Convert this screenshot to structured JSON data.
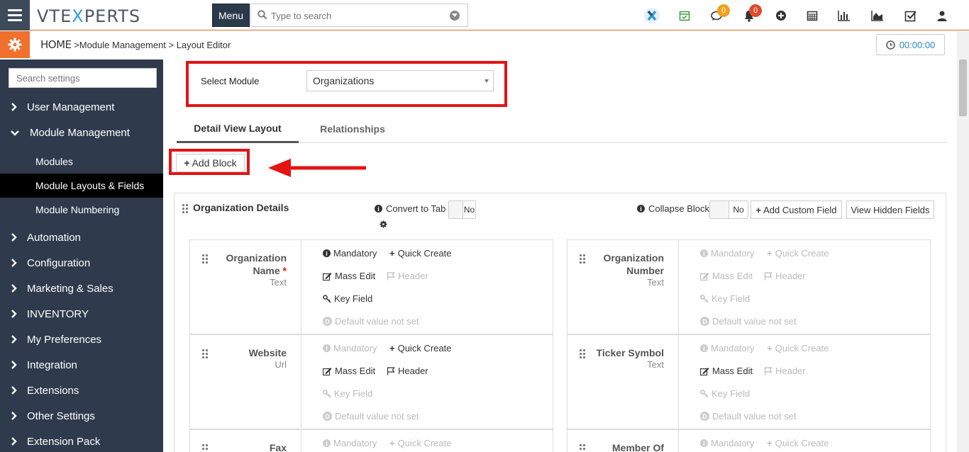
{
  "header": {
    "logo_prefix": "VTE",
    "logo_x": "X",
    "logo_suffix": "PERTS",
    "menu_label": "Menu",
    "search_placeholder": "Type to search",
    "chat_badge": "0",
    "notif_badge": "0"
  },
  "breadcrumb": {
    "home": "HOME",
    "sep1": " >",
    "module_mgmt": "Module Management",
    "sep2": " > ",
    "current": "Layout Editor"
  },
  "timer": "00:00:00",
  "sidebar": {
    "search_placeholder": "Search settings",
    "items": [
      {
        "label": "User Management"
      },
      {
        "label": "Module Management"
      },
      {
        "label": "Automation"
      },
      {
        "label": "Configuration"
      },
      {
        "label": "Marketing & Sales"
      },
      {
        "label": "INVENTORY"
      },
      {
        "label": "My Preferences"
      },
      {
        "label": "Integration"
      },
      {
        "label": "Extensions"
      },
      {
        "label": "Other Settings"
      },
      {
        "label": "Extension Pack"
      }
    ],
    "subitems": [
      {
        "label": "Modules"
      },
      {
        "label": "Module Layouts & Fields"
      },
      {
        "label": "Module Numbering"
      }
    ]
  },
  "main": {
    "select_module_label": "Select Module",
    "select_module_value": "Organizations",
    "tabs": [
      {
        "label": "Detail View Layout"
      },
      {
        "label": "Relationships"
      }
    ],
    "add_block_label": "Add Block",
    "block": {
      "title": "Organization Details",
      "convert_to_tab_label": "Convert to Tab",
      "convert_to_tab_value": "No",
      "collapse_block_label": "Collapse Block",
      "collapse_block_value": "No",
      "add_custom_field_label": "Add Custom Field",
      "view_hidden_fields_label": "View Hidden Fields"
    },
    "option_labels": {
      "mandatory": "Mandatory",
      "quick_create": "Quick Create",
      "mass_edit": "Mass Edit",
      "header": "Header",
      "key_field": "Key Field",
      "default_value": "Default value not set"
    },
    "fields": [
      {
        "name": "Organization Name",
        "required": "*",
        "type": "Text"
      },
      {
        "name": "Organization Number",
        "type": "Text"
      },
      {
        "name": "Website",
        "type": "Url"
      },
      {
        "name": "Ticker Symbol",
        "type": "Text"
      },
      {
        "name": "Fax",
        "type": ""
      },
      {
        "name": "Member Of",
        "type": ""
      }
    ]
  },
  "colors": {
    "accent": "#f0702e",
    "sidebar": "#2f3b4c",
    "annotation_red": "#e31414",
    "link_blue": "#2f86c6"
  }
}
